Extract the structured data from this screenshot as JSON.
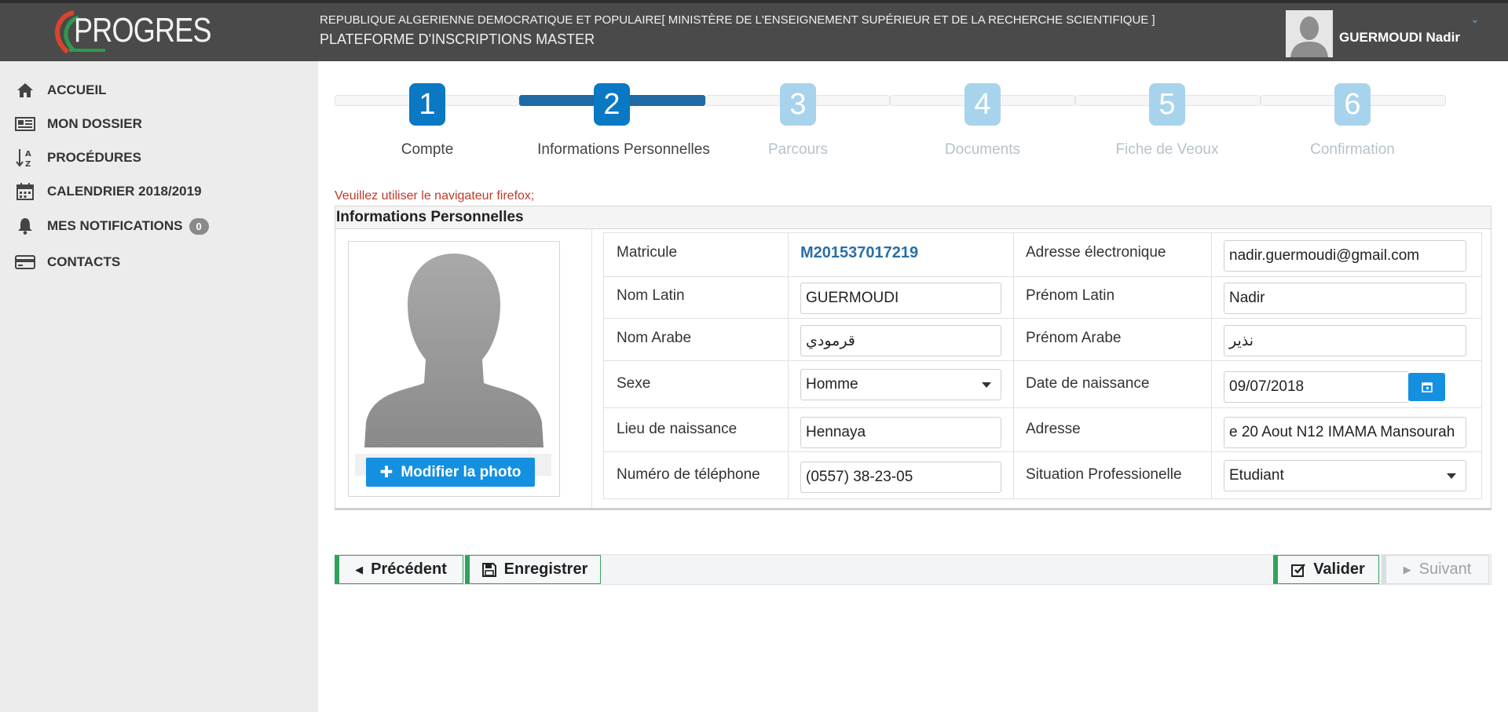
{
  "header": {
    "logo_text": "PROGRES",
    "line1": "REPUBLIQUE ALGERIENNE DEMOCRATIQUE ET POPULAIRE[ MINISTÈRE DE L'ENSEIGNEMENT SUPÉRIEUR ET DE LA RECHERCHE SCIENTIFIQUE ]",
    "line2": "PLATEFORME D'INSCRIPTIONS MASTER",
    "user_name": "GUERMOUDI Nadir",
    "user_caret": "⌄"
  },
  "sidebar": {
    "items": [
      {
        "label": "ACCUEIL",
        "icon": "home-icon"
      },
      {
        "label": "MON DOSSIER",
        "icon": "newspaper-icon"
      },
      {
        "label": "PROCÉDURES",
        "icon": "sort-alpha-icon"
      },
      {
        "label": "CALENDRIER 2018/2019",
        "icon": "calendar-icon"
      },
      {
        "label": "MES NOTIFICATIONS",
        "icon": "bell-icon",
        "badge": "0"
      },
      {
        "label": "CONTACTS",
        "icon": "credit-card-icon"
      }
    ]
  },
  "steps": [
    {
      "number": "1",
      "label": "Compte",
      "state": "done"
    },
    {
      "number": "2",
      "label": "Informations Personnelles",
      "state": "current"
    },
    {
      "number": "3",
      "label": "Parcours",
      "state": "todo"
    },
    {
      "number": "4",
      "label": "Documents",
      "state": "todo"
    },
    {
      "number": "5",
      "label": "Fiche de Veoux",
      "state": "todo"
    },
    {
      "number": "6",
      "label": "Confirmation",
      "state": "todo"
    }
  ],
  "warning": "Veuillez utiliser le navigateur firefox;",
  "panel": {
    "title": "Informations Personnelles",
    "photo_button": "Modifier la photo"
  },
  "form": {
    "matricule_label": "Matricule",
    "matricule_value": "M201537017219",
    "email_label": "Adresse électronique",
    "email_value": "nadir.guermoudi@gmail.com",
    "nom_latin_label": "Nom Latin",
    "nom_latin_value": "GUERMOUDI",
    "prenom_latin_label": "Prénom Latin",
    "prenom_latin_value": "Nadir",
    "nom_arabe_label": "Nom Arabe",
    "nom_arabe_value": "قرمودي",
    "prenom_arabe_label": "Prénom Arabe",
    "prenom_arabe_value": "نذير",
    "sexe_label": "Sexe",
    "sexe_value": "Homme",
    "naissance_label": "Date de naissance",
    "naissance_value": "09/07/2018",
    "lieu_label": "Lieu de naissance",
    "lieu_value": "Hennaya",
    "adresse_label": "Adresse",
    "adresse_value": "e 20 Aout N12 IMAMA Mansourah",
    "tel_label": "Numéro de téléphone",
    "tel_value": "(0557) 38-23-05",
    "situation_label": "Situation Professionelle",
    "situation_value": "Etudiant"
  },
  "actions": {
    "precedent": "Précédent",
    "enregistrer": "Enregistrer",
    "valider": "Valider",
    "suivant": "Suivant"
  },
  "colors": {
    "header_bg": "#4a4a4a",
    "sidebar_bg": "#ececec",
    "step_done": "#0a78c2",
    "step_todo": "#a8d3ec",
    "accent_button": "#1590e0",
    "warning_text": "#c0392b",
    "action_border": "#2fa35a"
  }
}
